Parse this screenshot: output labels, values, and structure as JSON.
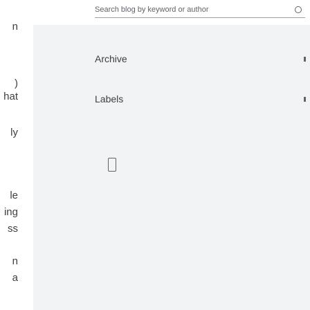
{
  "article": {
    "fragments": [
      "n",
      ")",
      "hat",
      "ly",
      "le",
      "ing",
      "ss",
      "n",
      "a"
    ]
  },
  "drawer": {
    "search": {
      "placeholder": "Search blog by keyword or author"
    },
    "menu": [
      {
        "label": "Archive"
      },
      {
        "label": "Labels"
      }
    ],
    "icons": {
      "search": "search-icon",
      "archive_expand": "chevron-icon",
      "labels_expand": "chevron-icon",
      "report": "report-abuse-icon"
    },
    "colors": {
      "drawer_background": "#f1f3f4",
      "text": "#3c4043",
      "muted": "#5f6368"
    }
  }
}
